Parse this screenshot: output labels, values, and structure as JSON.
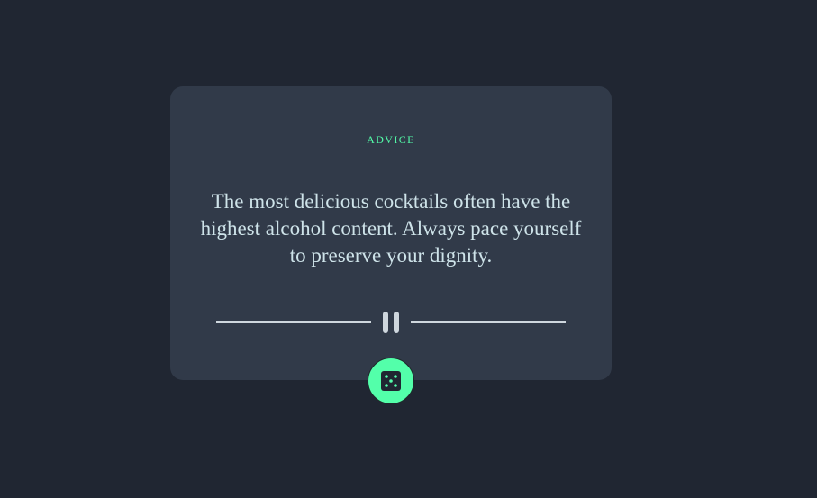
{
  "card": {
    "label": "ADVICE",
    "quote": "The most delicious cocktails often have the highest alcohol content. Always pace yourself to preserve your dignity."
  },
  "icons": {
    "divider": "pause-icon",
    "button": "dice-icon"
  },
  "colors": {
    "background": "#202632",
    "card": "#313a49",
    "accent": "#53ffaa",
    "text": "#cee3e9"
  }
}
